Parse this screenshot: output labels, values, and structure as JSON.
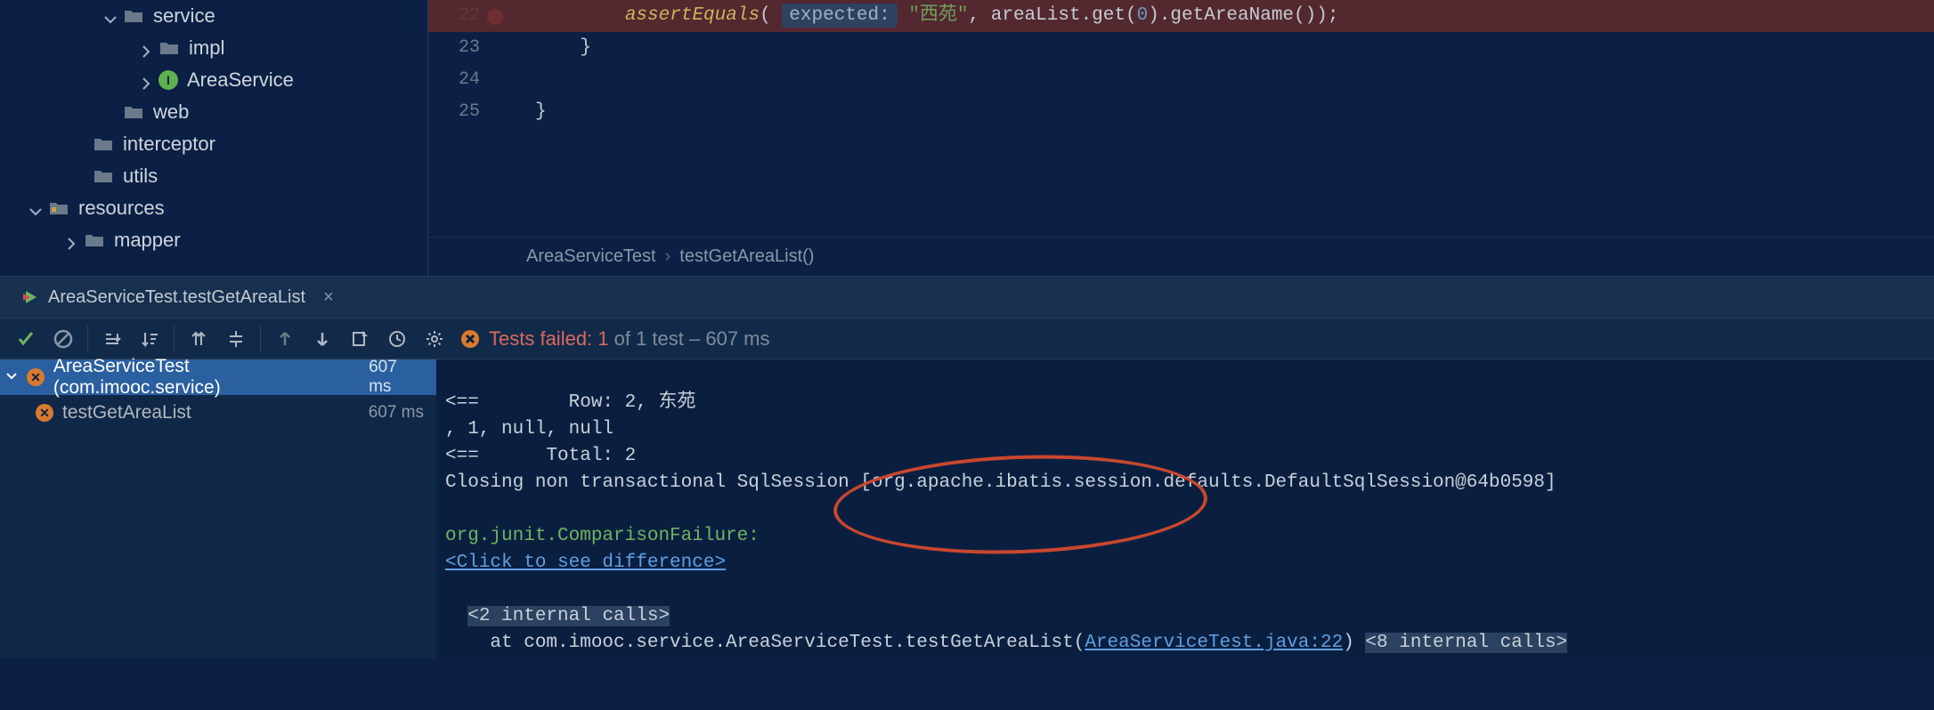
{
  "sidebar": {
    "items": [
      {
        "indent": 116,
        "arrow": "down",
        "icon": "folder",
        "label": "service"
      },
      {
        "indent": 156,
        "arrow": "right",
        "icon": "folder",
        "label": "impl"
      },
      {
        "indent": 156,
        "arrow": "right",
        "icon": "class",
        "label": "AreaService"
      },
      {
        "indent": 116,
        "arrow": "none",
        "icon": "folder",
        "label": "web"
      },
      {
        "indent": 82,
        "arrow": "none",
        "icon": "folder",
        "label": "interceptor"
      },
      {
        "indent": 82,
        "arrow": "none",
        "icon": "folder",
        "label": "utils"
      },
      {
        "indent": 32,
        "arrow": "down",
        "icon": "res-folder",
        "label": "resources"
      },
      {
        "indent": 72,
        "arrow": "right",
        "icon": "folder",
        "label": "mapper"
      }
    ]
  },
  "editor": {
    "lines": [
      "22",
      "23",
      "24",
      "25"
    ],
    "breakpoint_at": "22",
    "code": {
      "fn": "assertEquals",
      "hint": "expected:",
      "str": "\"西苑\"",
      "var1": "areaList",
      "call1": ".get(",
      "num1": "0",
      "call2": ").getAreaName());",
      "close1": "}",
      "close2": "}"
    },
    "breadcrumb": {
      "a": "AreaServiceTest",
      "b": "testGetAreaList()"
    }
  },
  "tab": {
    "label": "AreaServiceTest.testGetAreaList"
  },
  "status": {
    "fail_prefix": "Tests failed: 1",
    "fail_suffix": " of 1 test – 607 ms"
  },
  "tests": {
    "root": {
      "label": "AreaServiceTest (com.imooc.service)",
      "ms": "607 ms"
    },
    "child": {
      "label": "testGetAreaList",
      "ms": "607 ms"
    }
  },
  "console": {
    "l1a": "<==        Row: 2, 东苑",
    "l2": ", 1, null, null",
    "l3": "<==      Total: 2",
    "l4": "Closing non transactional SqlSession [org.apache.ibatis.session.defaults.DefaultSqlSession@64b0598]",
    "l5": "",
    "l6": "org.junit.ComparisonFailure: ",
    "l7": "<Click to see difference>",
    "l8": "",
    "l9": "<2 internal calls>",
    "l10a": "    at com.imooc.service.AreaServiceTest.testGetAreaList(",
    "l10link": "AreaServiceTest.java:22",
    "l10b": ") ",
    "l10c": "<8 internal calls>"
  }
}
